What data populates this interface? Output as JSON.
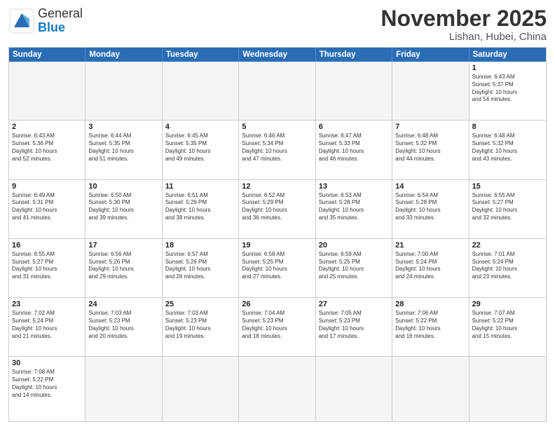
{
  "header": {
    "logo_general": "General",
    "logo_blue": "Blue",
    "month_title": "November 2025",
    "location": "Lishan, Hubei, China"
  },
  "weekdays": [
    "Sunday",
    "Monday",
    "Tuesday",
    "Wednesday",
    "Thursday",
    "Friday",
    "Saturday"
  ],
  "weeks": [
    [
      {
        "day": "",
        "text": ""
      },
      {
        "day": "",
        "text": ""
      },
      {
        "day": "",
        "text": ""
      },
      {
        "day": "",
        "text": ""
      },
      {
        "day": "",
        "text": ""
      },
      {
        "day": "",
        "text": ""
      },
      {
        "day": "1",
        "text": "Sunrise: 6:43 AM\nSunset: 5:37 PM\nDaylight: 10 hours\nand 54 minutes."
      }
    ],
    [
      {
        "day": "2",
        "text": "Sunrise: 6:43 AM\nSunset: 5:36 PM\nDaylight: 10 hours\nand 52 minutes."
      },
      {
        "day": "3",
        "text": "Sunrise: 6:44 AM\nSunset: 5:35 PM\nDaylight: 10 hours\nand 51 minutes."
      },
      {
        "day": "4",
        "text": "Sunrise: 6:45 AM\nSunset: 5:35 PM\nDaylight: 10 hours\nand 49 minutes."
      },
      {
        "day": "5",
        "text": "Sunrise: 6:46 AM\nSunset: 5:34 PM\nDaylight: 10 hours\nand 47 minutes."
      },
      {
        "day": "6",
        "text": "Sunrise: 6:47 AM\nSunset: 5:33 PM\nDaylight: 10 hours\nand 46 minutes."
      },
      {
        "day": "7",
        "text": "Sunrise: 6:48 AM\nSunset: 5:32 PM\nDaylight: 10 hours\nand 44 minutes."
      },
      {
        "day": "8",
        "text": "Sunrise: 6:48 AM\nSunset: 5:32 PM\nDaylight: 10 hours\nand 43 minutes."
      }
    ],
    [
      {
        "day": "9",
        "text": "Sunrise: 6:49 AM\nSunset: 5:31 PM\nDaylight: 10 hours\nand 41 minutes."
      },
      {
        "day": "10",
        "text": "Sunrise: 6:50 AM\nSunset: 5:30 PM\nDaylight: 10 hours\nand 39 minutes."
      },
      {
        "day": "11",
        "text": "Sunrise: 6:51 AM\nSunset: 5:29 PM\nDaylight: 10 hours\nand 38 minutes."
      },
      {
        "day": "12",
        "text": "Sunrise: 6:52 AM\nSunset: 5:29 PM\nDaylight: 10 hours\nand 36 minutes."
      },
      {
        "day": "13",
        "text": "Sunrise: 6:53 AM\nSunset: 5:28 PM\nDaylight: 10 hours\nand 35 minutes."
      },
      {
        "day": "14",
        "text": "Sunrise: 6:54 AM\nSunset: 5:28 PM\nDaylight: 10 hours\nand 33 minutes."
      },
      {
        "day": "15",
        "text": "Sunrise: 6:55 AM\nSunset: 5:27 PM\nDaylight: 10 hours\nand 32 minutes."
      }
    ],
    [
      {
        "day": "16",
        "text": "Sunrise: 6:55 AM\nSunset: 5:27 PM\nDaylight: 10 hours\nand 31 minutes."
      },
      {
        "day": "17",
        "text": "Sunrise: 6:56 AM\nSunset: 5:26 PM\nDaylight: 10 hours\nand 29 minutes."
      },
      {
        "day": "18",
        "text": "Sunrise: 6:57 AM\nSunset: 5:26 PM\nDaylight: 10 hours\nand 28 minutes."
      },
      {
        "day": "19",
        "text": "Sunrise: 6:58 AM\nSunset: 5:25 PM\nDaylight: 10 hours\nand 27 minutes."
      },
      {
        "day": "20",
        "text": "Sunrise: 6:59 AM\nSunset: 5:25 PM\nDaylight: 10 hours\nand 25 minutes."
      },
      {
        "day": "21",
        "text": "Sunrise: 7:00 AM\nSunset: 5:24 PM\nDaylight: 10 hours\nand 24 minutes."
      },
      {
        "day": "22",
        "text": "Sunrise: 7:01 AM\nSunset: 5:24 PM\nDaylight: 10 hours\nand 23 minutes."
      }
    ],
    [
      {
        "day": "23",
        "text": "Sunrise: 7:02 AM\nSunset: 5:24 PM\nDaylight: 10 hours\nand 21 minutes."
      },
      {
        "day": "24",
        "text": "Sunrise: 7:03 AM\nSunset: 5:23 PM\nDaylight: 10 hours\nand 20 minutes."
      },
      {
        "day": "25",
        "text": "Sunrise: 7:03 AM\nSunset: 5:23 PM\nDaylight: 10 hours\nand 19 minutes."
      },
      {
        "day": "26",
        "text": "Sunrise: 7:04 AM\nSunset: 5:23 PM\nDaylight: 10 hours\nand 18 minutes."
      },
      {
        "day": "27",
        "text": "Sunrise: 7:05 AM\nSunset: 5:23 PM\nDaylight: 10 hours\nand 17 minutes."
      },
      {
        "day": "28",
        "text": "Sunrise: 7:06 AM\nSunset: 5:22 PM\nDaylight: 10 hours\nand 16 minutes."
      },
      {
        "day": "29",
        "text": "Sunrise: 7:07 AM\nSunset: 5:22 PM\nDaylight: 10 hours\nand 15 minutes."
      }
    ],
    [
      {
        "day": "30",
        "text": "Sunrise: 7:08 AM\nSunset: 5:22 PM\nDaylight: 10 hours\nand 14 minutes."
      },
      {
        "day": "",
        "text": ""
      },
      {
        "day": "",
        "text": ""
      },
      {
        "day": "",
        "text": ""
      },
      {
        "day": "",
        "text": ""
      },
      {
        "day": "",
        "text": ""
      },
      {
        "day": "",
        "text": ""
      }
    ]
  ]
}
